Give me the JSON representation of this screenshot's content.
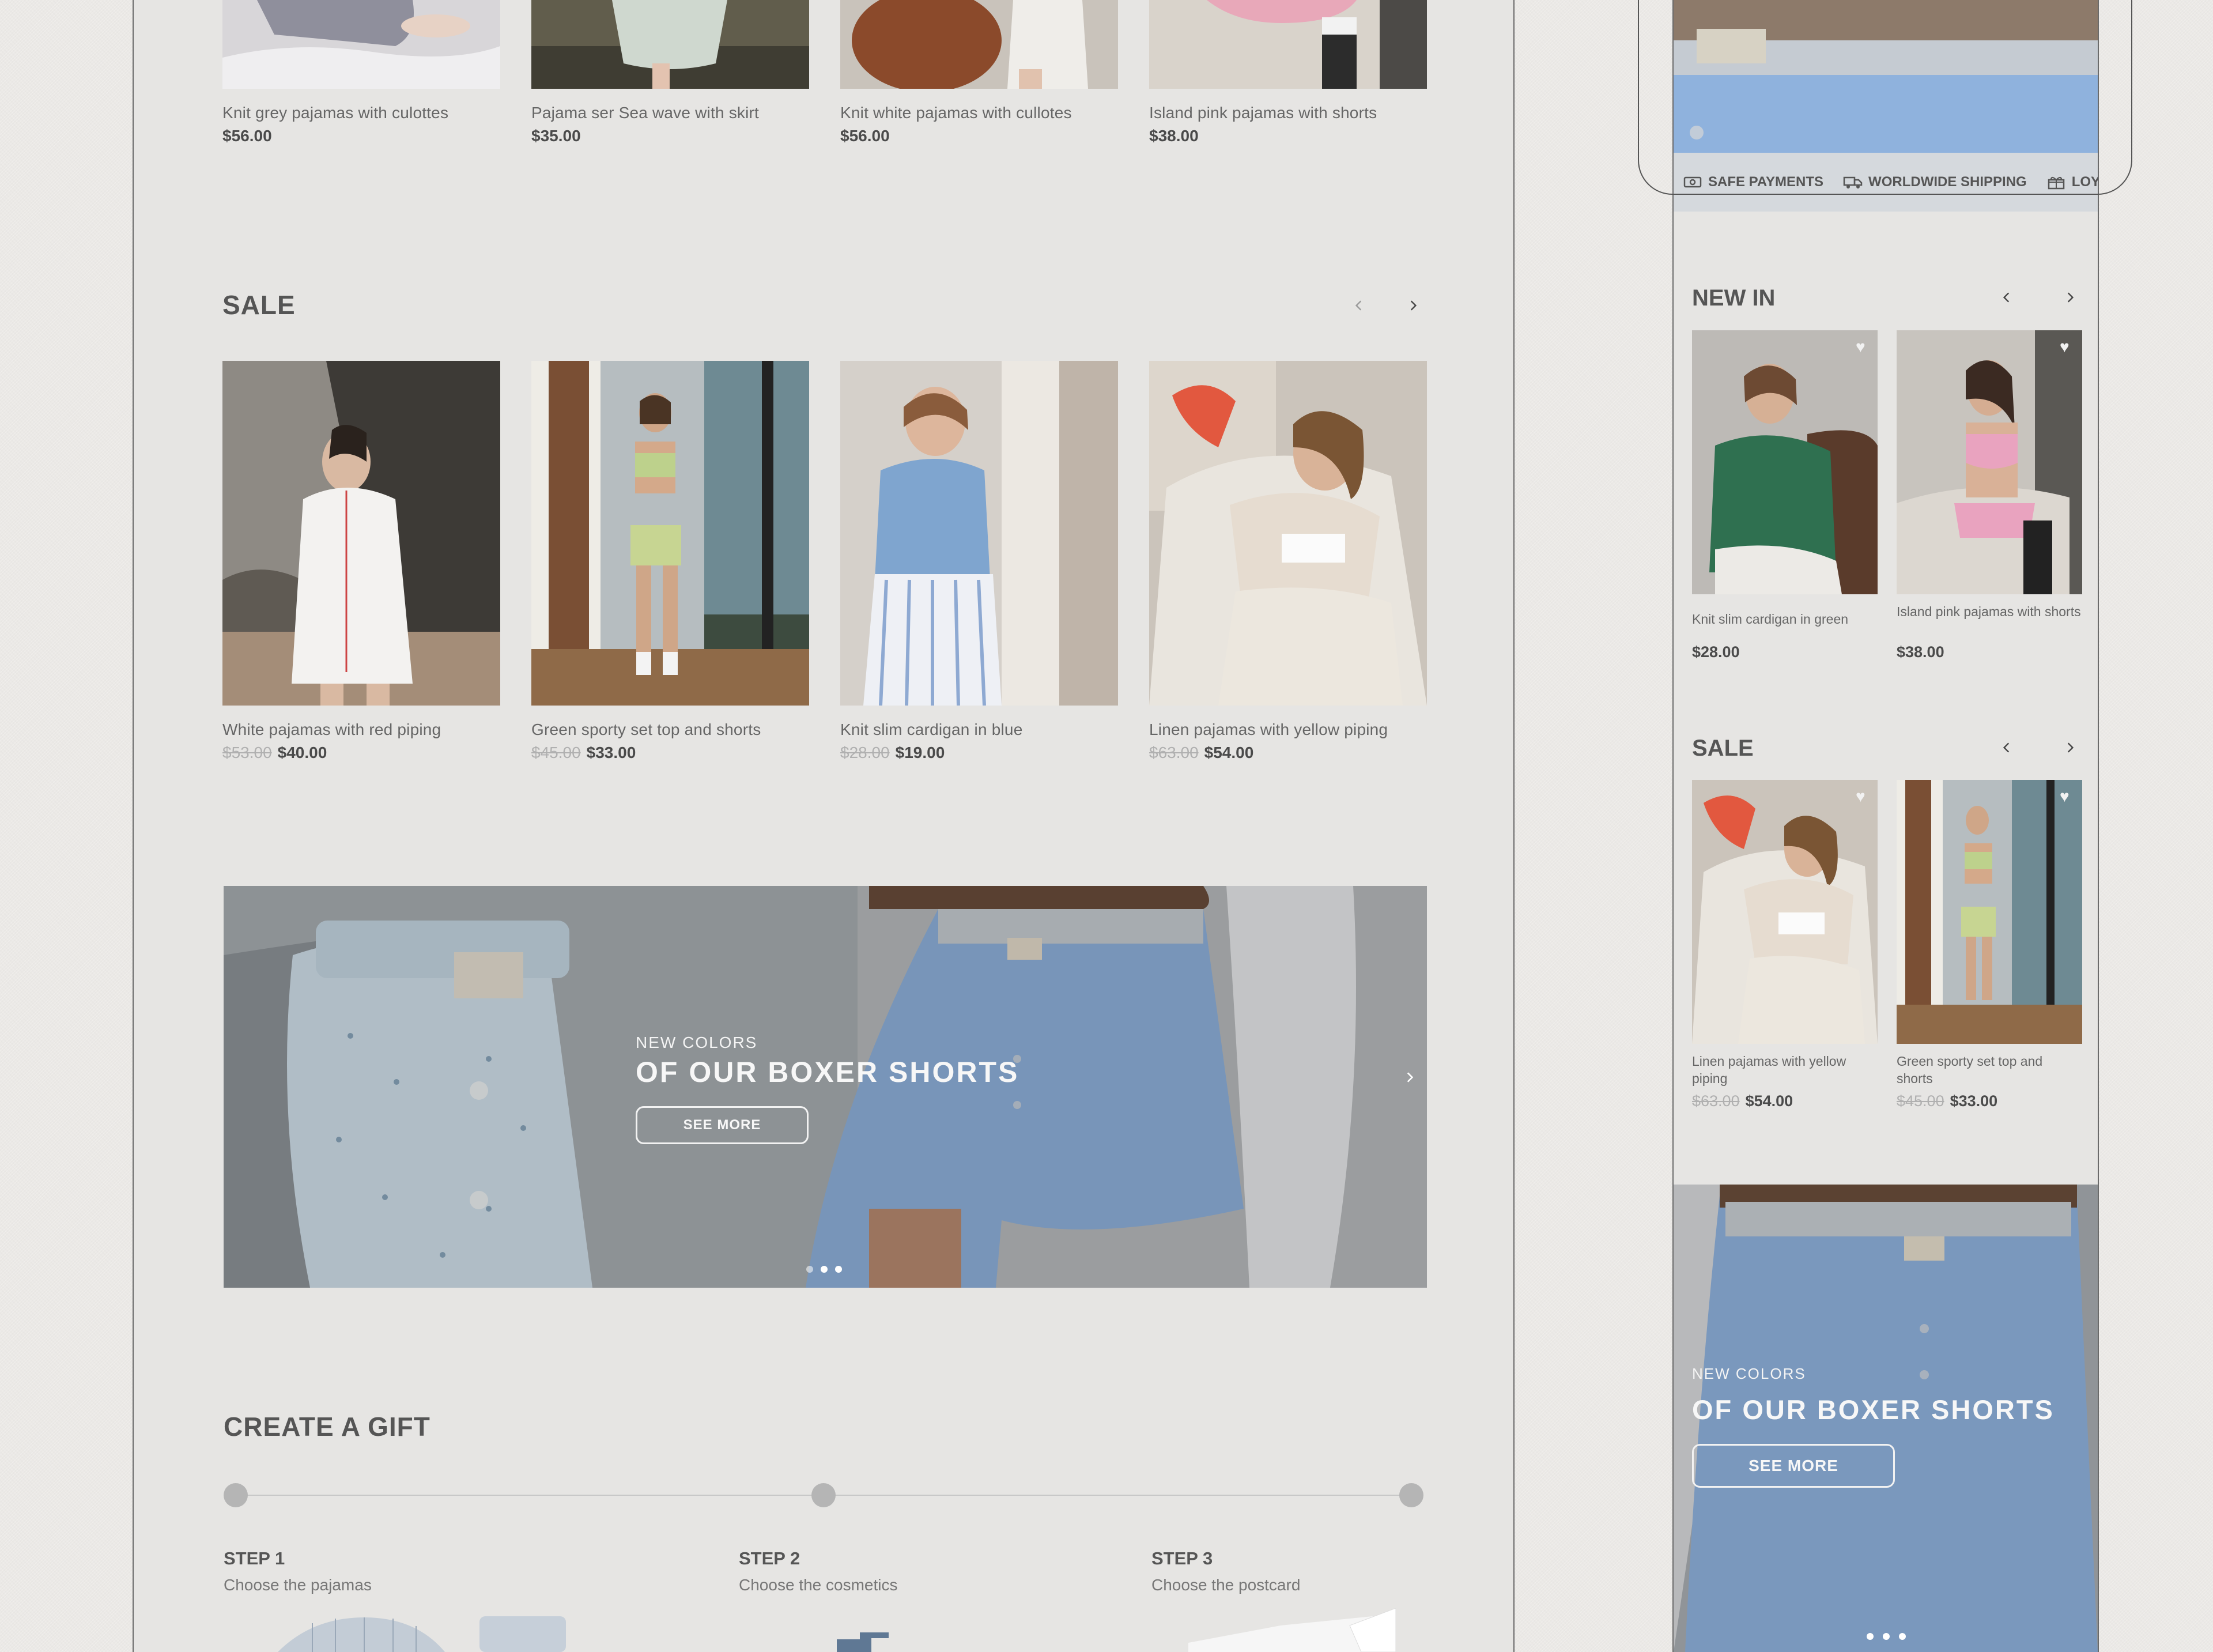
{
  "top_products": [
    {
      "name": "Knit grey pajamas with culottes",
      "price": "$56.00"
    },
    {
      "name": "Pajama ser Sea wave with skirt",
      "price": "$35.00"
    },
    {
      "name": "Knit white pajamas with cullotes",
      "price": "$56.00"
    },
    {
      "name": "Island pink pajamas with shorts",
      "price": "$38.00"
    }
  ],
  "sale": {
    "title": "SALE",
    "items": [
      {
        "name": "White pajamas with red piping",
        "old": "$53.00",
        "price": "$40.00"
      },
      {
        "name": "Green sporty set top and shorts",
        "old": "$45.00",
        "price": "$33.00"
      },
      {
        "name": "Knit slim cardigan in blue",
        "old": "$28.00",
        "price": "$19.00"
      },
      {
        "name": "Linen pajamas with yellow piping",
        "old": "$63.00",
        "price": "$54.00"
      }
    ]
  },
  "banner": {
    "subtitle": "NEW COLORS",
    "title": "OF OUR BOXER SHORTS",
    "button": "SEE MORE"
  },
  "gift": {
    "title": "CREATE A GIFT",
    "steps": [
      {
        "title": "STEP 1",
        "desc": "Choose the pajamas"
      },
      {
        "title": "STEP 2",
        "desc": "Choose the cosmetics"
      },
      {
        "title": "STEP 3",
        "desc": "Choose the postcard"
      }
    ]
  },
  "mobile": {
    "trust": [
      "SAFE PAYMENTS",
      "WORLDWIDE SHIPPING",
      "LOYALTY"
    ],
    "new_in": {
      "title": "NEW IN",
      "items": [
        {
          "name": "Knit slim cardigan in green",
          "price": "$28.00"
        },
        {
          "name": "Island pink pajamas with shorts",
          "price": "$38.00"
        }
      ]
    },
    "sale": {
      "title": "SALE",
      "items": [
        {
          "name": "Linen pajamas with yellow piping",
          "old": "$63.00",
          "price": "$54.00"
        },
        {
          "name": "Green sporty  set top and shorts",
          "old": "$45.00",
          "price": "$33.00"
        }
      ]
    },
    "banner": {
      "subtitle": "NEW COLORS",
      "title": "OF OUR BOXER SHORTS",
      "button": "SEE MORE"
    }
  },
  "colors": {
    "background": "#ebe9e6",
    "panel": "#e6e5e3",
    "trust_bar": "#d5d9dd",
    "banner_blue": "#8fb2dd"
  }
}
